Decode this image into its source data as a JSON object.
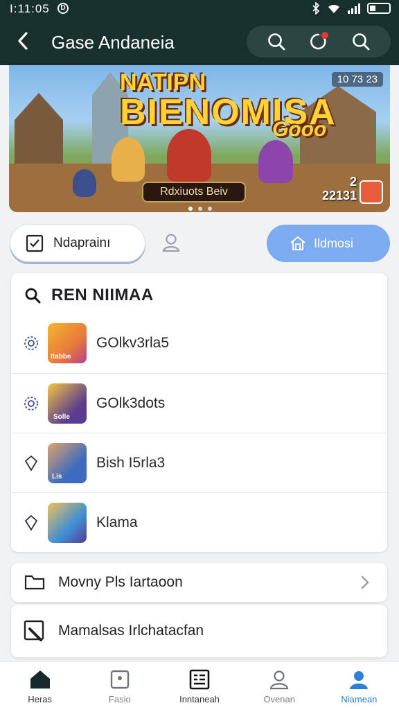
{
  "status": {
    "time": "I:11:05",
    "dot_glyph": "D"
  },
  "appbar": {
    "title": "Gase Andaneia"
  },
  "banner": {
    "title_line1": "NATIPN",
    "title_line2": "BIENOMISA",
    "title_tail": "Gooo",
    "cta": "Rdxiuots Beiv",
    "score_top": "10 73 23",
    "score_bottom_1": "2",
    "score_bottom_2": "22131",
    "slides_total": 3,
    "slide_active": 1
  },
  "tabs": {
    "left_label": "Ndaprainı",
    "right_label": "Ildmosi"
  },
  "list": {
    "heading": "REN NIIMAA",
    "items": [
      {
        "label": "GOlkv3rla5",
        "thumb_text": "Itabbe",
        "thumb_color": "#e8793a"
      },
      {
        "label": "GOlk3dots",
        "thumb_text": "Solle",
        "thumb_color": "#5a3b8f"
      },
      {
        "label": "Bish I5rla3",
        "thumb_text": "Lis",
        "thumb_color": "#3d6bbf"
      },
      {
        "label": "Klama",
        "thumb_text": "",
        "thumb_color": "#3e8fd6"
      }
    ]
  },
  "nav_row": {
    "label": "Movny Pls Iartaoon"
  },
  "last_row": {
    "label": "Mamalsas Irlchatacfan"
  },
  "bottom_nav": [
    {
      "label": "Heras",
      "icon": "home-icon"
    },
    {
      "label": "Fasio",
      "icon": "image-icon"
    },
    {
      "label": "Inntaneah",
      "icon": "news-icon"
    },
    {
      "label": "Ovenan",
      "icon": "user-icon"
    },
    {
      "label": "Niamean",
      "icon": "profile-icon"
    }
  ],
  "colors": {
    "header": "#17302e",
    "accent": "#2d7fd8",
    "tab_active": "#7cabef",
    "badge": "#e53935"
  }
}
